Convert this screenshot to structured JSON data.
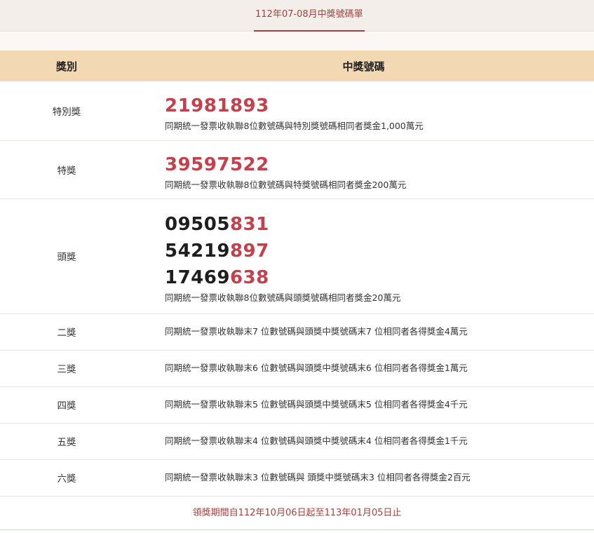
{
  "tab": {
    "label": "112年07-08月中獎號碼單"
  },
  "table": {
    "headers": {
      "category": "獎別",
      "numbers": "中獎號碼"
    }
  },
  "prizes": {
    "special": {
      "name": "特別獎",
      "number": {
        "prefix": "",
        "suffix": "21981893"
      },
      "desc": "同期統一發票收執聯8位數號碼與特別獎號碼相同者獎金1,000萬元"
    },
    "grand": {
      "name": "特獎",
      "number": {
        "prefix": "",
        "suffix": "39597522"
      },
      "desc": "同期統一發票收執聯8位數號碼與特獎號碼相同者獎金200萬元"
    },
    "first": {
      "name": "頭獎",
      "numbers": [
        {
          "prefix": "09505",
          "suffix": "831"
        },
        {
          "prefix": "54219",
          "suffix": "897"
        },
        {
          "prefix": "17469",
          "suffix": "638"
        }
      ],
      "desc": "同期統一發票收執聯8位數號碼與頭獎號碼相同者獎金20萬元"
    },
    "second": {
      "name": "二獎",
      "desc": "同期統一發票收執聯末7 位數號碼與頭獎中獎號碼末7 位相同者各得獎金4萬元"
    },
    "third": {
      "name": "三獎",
      "desc": "同期統一發票收執聯末6 位數號碼與頭獎中獎號碼末6 位相同者各得獎金1萬元"
    },
    "fourth": {
      "name": "四獎",
      "desc": "同期統一發票收執聯末5 位數號碼與頭獎中獎號碼末5 位相同者各得獎金4千元"
    },
    "fifth": {
      "name": "五獎",
      "desc": "同期統一發票收執聯末4 位數號碼與頭獎中獎號碼末4 位相同者各得獎金1千元"
    },
    "sixth": {
      "name": "六獎",
      "desc": "同期統一發票收執聯末3 位數號碼與 頭獎中獎號碼末3 位相同者各得獎金2百元"
    }
  },
  "footer": {
    "text": "領獎期間自112年10月06日起至113年01月05日止"
  },
  "colors": {
    "accent": "#a0413d",
    "number_red": "#c2414d",
    "header_bg": "#f2d9b3",
    "tabbar_bg": "#f3eeea"
  }
}
